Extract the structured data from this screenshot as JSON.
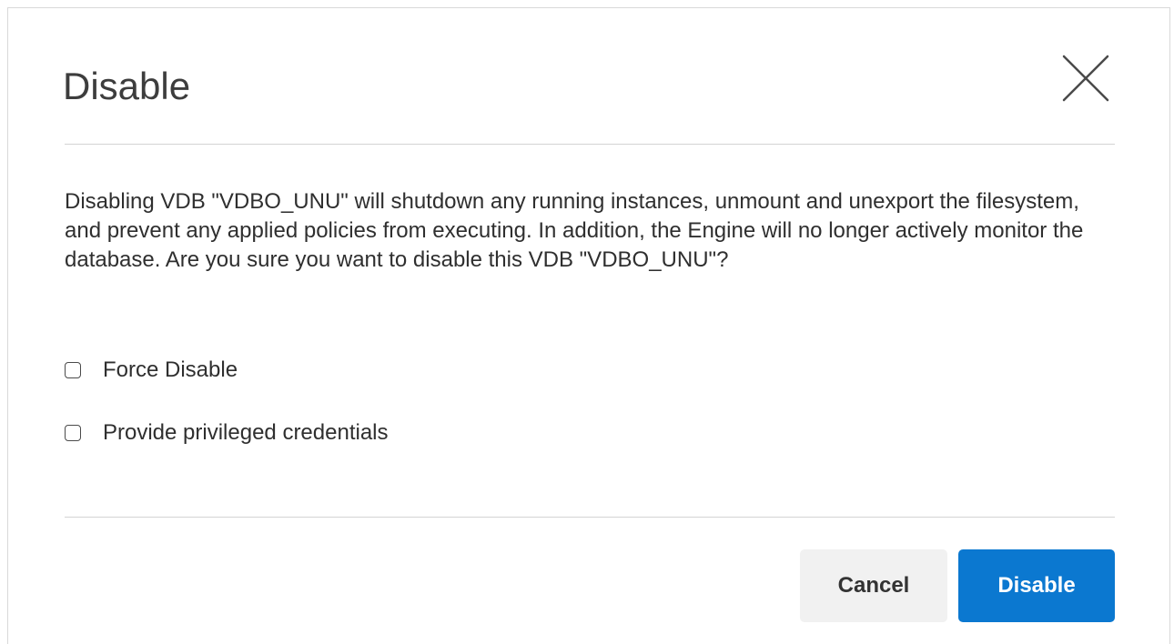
{
  "dialog": {
    "title": "Disable",
    "message": "Disabling VDB \"VDBO_UNU\" will shutdown any running instances, unmount and unexport the filesystem, and prevent any applied policies from executing. In addition, the Engine will no longer actively monitor the database. Are you sure you want to disable this VDB \"VDBO_UNU\"?",
    "close_icon": "close-icon",
    "options": [
      {
        "label": "Force Disable",
        "checked": false
      },
      {
        "label": "Provide privileged credentials",
        "checked": false
      }
    ],
    "buttons": {
      "cancel_label": "Cancel",
      "confirm_label": "Disable"
    },
    "colors": {
      "primary": "#0b78d0",
      "secondary_bg": "#f1f1f1",
      "divider": "#d4d4d4"
    }
  }
}
